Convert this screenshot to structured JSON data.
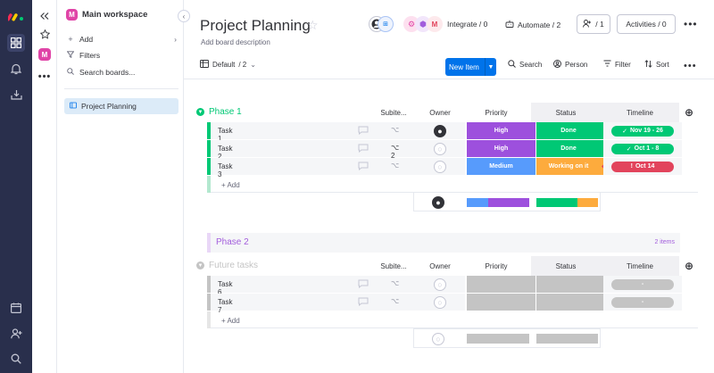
{
  "rail": {
    "items": [
      "logo-icon",
      "grid-icon",
      "bell-icon",
      "inbox-icon",
      "more-icon",
      "calendar-icon",
      "add-user-icon",
      "search-icon"
    ]
  },
  "strip": {
    "avatar_letter": "M"
  },
  "panel": {
    "workspace_name": "Main workspace",
    "avatar_letter": "M",
    "add_label": "Add",
    "filters_label": "Filters",
    "search_label": "Search boards...",
    "board_name": "Project Planning"
  },
  "header": {
    "title": "Project Planning",
    "description": "Add board description",
    "integrate_label": "Integrate / 0",
    "automate_label": "Automate / 2",
    "people_count": "/ 1",
    "activities_label": "Activities / 0"
  },
  "toolbar": {
    "view_label": "Default",
    "view_count": "/ 2",
    "new_item_label": "New Item",
    "search_label": "Search",
    "person_label": "Person",
    "filter_label": "Filter",
    "sort_label": "Sort"
  },
  "columns": {
    "subitems": "Subite...",
    "owner": "Owner",
    "priority": "Priority",
    "status": "Status",
    "timeline": "Timeline"
  },
  "groups": [
    {
      "title": "Phase 1",
      "color": "#00c875",
      "add_label": "+ Add",
      "rows": [
        {
          "name": "Task 1",
          "subitems": "",
          "owner": "filled",
          "priority": "High",
          "priority_color": "#9d50dd",
          "status": "Done",
          "status_color": "#00c875",
          "timeline": "Nov 19 - 26",
          "timeline_color": "#00c875"
        },
        {
          "name": "Task 2",
          "subitems": "2",
          "owner": "empty",
          "priority": "High",
          "priority_color": "#9d50dd",
          "status": "Done",
          "status_color": "#00c875",
          "timeline": "Oct 1 - 8",
          "timeline_color": "#00c875"
        },
        {
          "name": "Task 3",
          "subitems": "",
          "owner": "empty",
          "priority": "Medium",
          "priority_color": "#579bfc",
          "status": "Working on it",
          "status_color": "#fdab3d",
          "timeline": "Oct 14",
          "timeline_color": "#e2445c"
        }
      ]
    },
    {
      "title": "Phase 2",
      "color": "#a25ddc",
      "count_label": "2 items"
    },
    {
      "title": "Future tasks",
      "color": "#c4c4c4",
      "add_label": "+ Add",
      "rows": [
        {
          "name": "Task 6",
          "timeline": "-"
        },
        {
          "name": "Task 7",
          "timeline": "-"
        }
      ]
    }
  ]
}
